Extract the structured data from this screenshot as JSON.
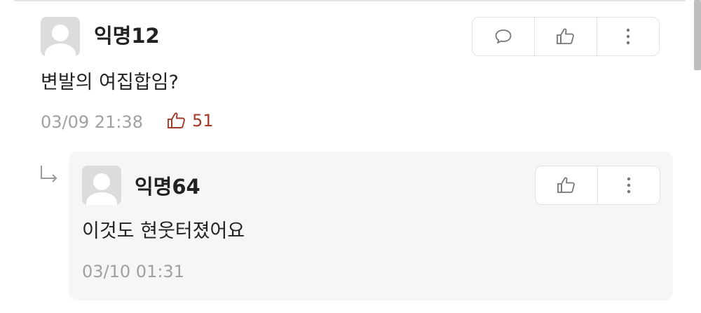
{
  "comment": {
    "nickname": "익명12",
    "text": "변발의 여집합임?",
    "time": "03/09 21:38",
    "likes": "51",
    "actions": [
      "comment-icon",
      "thumbs-up-icon",
      "more-vertical-icon"
    ]
  },
  "reply": {
    "nickname": "익명64",
    "text": "이것도 현웃터졌어요",
    "time": "03/10 01:31",
    "actions": [
      "thumbs-up-icon",
      "more-vertical-icon"
    ]
  },
  "colors": {
    "vote": "#a33a2a",
    "meta": "#a0a0a0",
    "reply_bg": "#f6f6f6"
  }
}
